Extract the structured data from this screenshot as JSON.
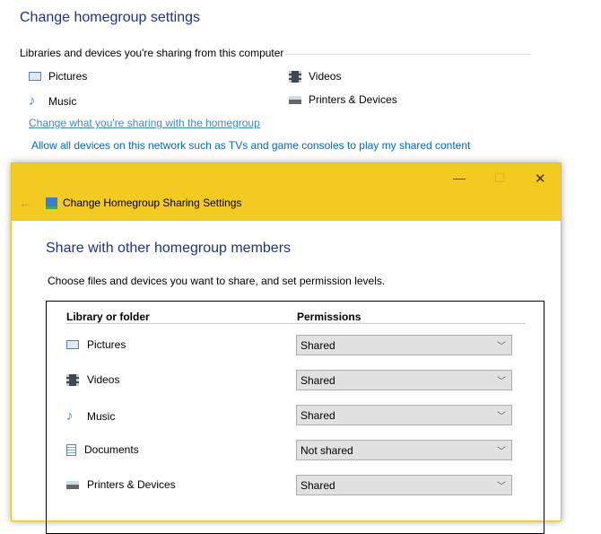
{
  "background": {
    "title": "Change homegroup settings",
    "section_label": "Libraries and devices you're sharing from this computer",
    "shared_items": [
      {
        "label": "Pictures",
        "icon": "pictures-icon"
      },
      {
        "label": "Videos",
        "icon": "videos-icon"
      },
      {
        "label": "Music",
        "icon": "music-icon"
      },
      {
        "label": "Printers & Devices",
        "icon": "printer-icon"
      }
    ],
    "link_change": "Change what you're sharing with the homegroup",
    "link_allow": "Allow all devices on this network such as TVs and game consoles to play my shared content"
  },
  "dialog": {
    "title": "Change Homegroup Sharing Settings",
    "accent": "#f2ca21",
    "heading": "Share with other homegroup members",
    "description": "Choose files and devices you want to share, and set permission levels.",
    "col_library": "Library or folder",
    "col_permissions": "Permissions",
    "rows": [
      {
        "label": "Pictures",
        "permission": "Shared"
      },
      {
        "label": "Videos",
        "permission": "Shared"
      },
      {
        "label": "Music",
        "permission": "Shared"
      },
      {
        "label": "Documents",
        "permission": "Not shared"
      },
      {
        "label": "Printers & Devices",
        "permission": "Shared"
      }
    ]
  }
}
